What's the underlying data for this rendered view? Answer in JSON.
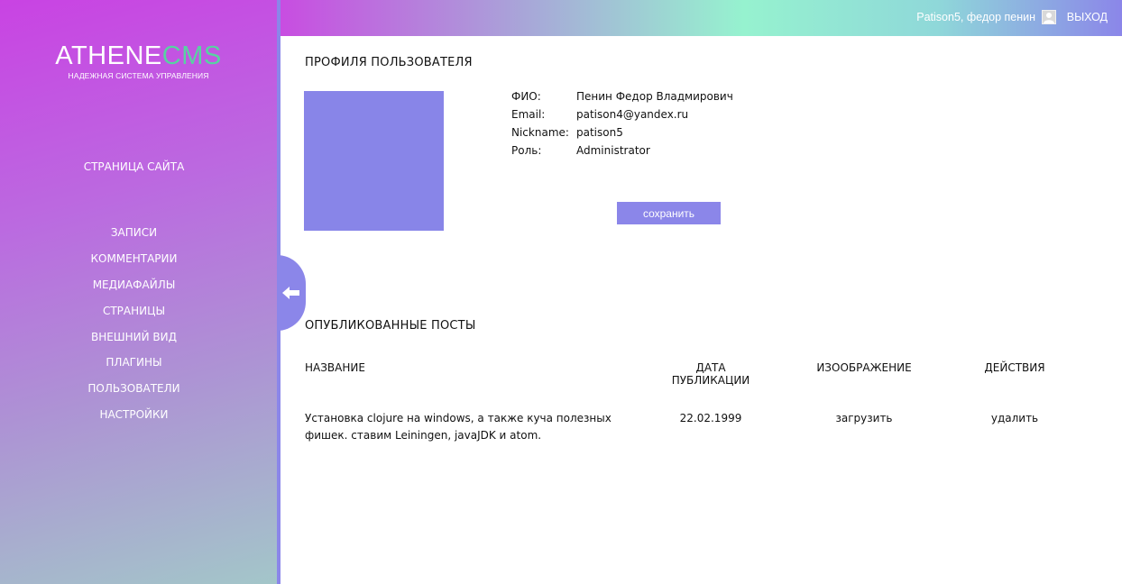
{
  "sidebar": {
    "logo_main": "ATHENE",
    "logo_accent": "CMS",
    "logo_sub": "НАДЕЖНАЯ СИСТЕМА УПРАВЛЕНИЯ",
    "site_link": "СТРАНИЦА САЙТА",
    "items": [
      {
        "label": "ЗАПИСИ"
      },
      {
        "label": "КОММЕНТАРИИ"
      },
      {
        "label": "МЕДИАФАЙЛЫ"
      },
      {
        "label": "СТРАНИЦЫ"
      },
      {
        "label": "ВНЕШНИЙ ВИД"
      },
      {
        "label": "ПЛАГИНЫ"
      },
      {
        "label": "ПОЛЬЗОВАТЕЛИ"
      },
      {
        "label": "НАСТРОЙКИ"
      }
    ],
    "collapse_icon": "arrow-left-icon"
  },
  "topbar": {
    "user": "Patison5, федор пенин",
    "avatar_icon": "user-icon",
    "logout": "ВЫХОД"
  },
  "profile": {
    "title": "ПРОФИЛЯ ПОЛЬЗОВАТЕЛЯ",
    "fields": [
      {
        "label": "ФИО:",
        "value": "Пенин Федор Владмирович"
      },
      {
        "label": "Email:",
        "value": "patison4@yandex.ru"
      },
      {
        "label": "Nickname:",
        "value": "patison5"
      },
      {
        "label": "Роль:",
        "value": "Administrator"
      }
    ],
    "save_label": "сохранить"
  },
  "posts": {
    "title": "ОПУБЛИКОВАННЫЕ ПОСТЫ",
    "columns": [
      "НАЗВАНИЕ",
      "ДАТА ПУБЛИКАЦИИ",
      "ИЗООБРАЖЕНИЕ",
      "ДЕЙСТВИЯ"
    ],
    "rows": [
      {
        "name": "Установка clojure на windows, а также куча полезных фишек. ставим Leiningen, javaJDK и atom.",
        "date": "22.02.1999",
        "image_action": "загрузить",
        "action": "удалить"
      }
    ]
  },
  "colors": {
    "accent": "#8b86e9",
    "logo_accent": "#58d2a2"
  }
}
